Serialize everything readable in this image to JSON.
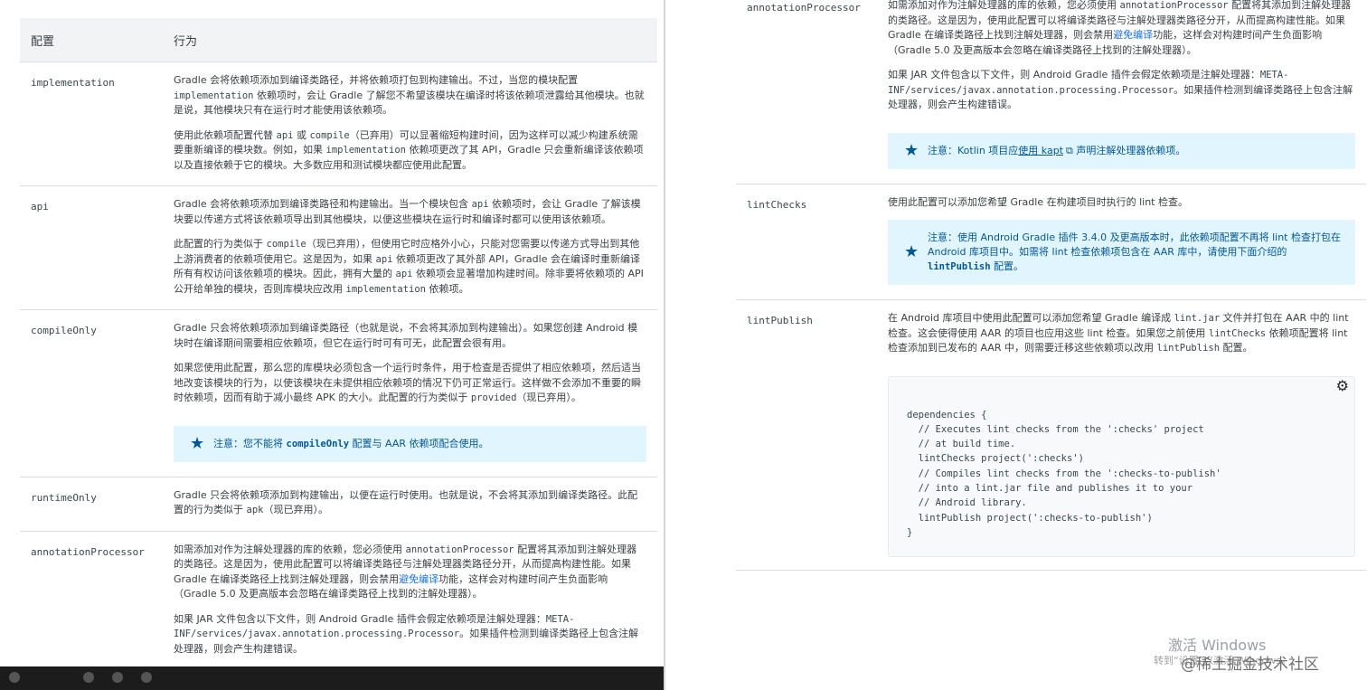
{
  "left": {
    "header": {
      "config": "配置",
      "behavior": "行为"
    },
    "rows": [
      {
        "name": "implementation",
        "paras": [
          [
            "Gradle 会将依赖项添加到编译类路径，并将依赖项打包到构建输出。不过，当您的模块配置 ",
            {
              "code": "implementation"
            },
            " 依赖项时，会让 Gradle 了解您不希望该模块在编译时将该依赖项泄露给其他模块。也就是说，其他模块只有在运行时才能使用该依赖项。"
          ],
          [
            "使用此依赖项配置代替 ",
            {
              "code": "api"
            },
            " 或 ",
            {
              "code": "compile"
            },
            "（已弃用）可以显著缩短构建时间，因为这样可以减少构建系统需要重新编译的模块数。例如，如果 ",
            {
              "code": "implementation"
            },
            " 依赖项更改了其 API，Gradle 只会重新编译该依赖项以及直接依赖于它的模块。大多数应用和测试模块都应使用此配置。"
          ]
        ]
      },
      {
        "name": "api",
        "paras": [
          [
            "Gradle 会将依赖项添加到编译类路径和构建输出。当一个模块包含 ",
            {
              "code": "api"
            },
            " 依赖项时，会让 Gradle 了解该模块要以传递方式将该依赖项导出到其他模块，以便这些模块在运行时和编译时都可以使用该依赖项。"
          ],
          [
            "此配置的行为类似于 ",
            {
              "code": "compile"
            },
            "（现已弃用），但使用它时应格外小心，只能对您需要以传递方式导出到其他上游消费者的依赖项使用它。这是因为，如果 ",
            {
              "code": "api"
            },
            " 依赖项更改了其外部 API，Gradle 会在编译时重新编译所有有权访问该依赖项的模块。因此，拥有大量的 ",
            {
              "code": "api"
            },
            " 依赖项会显著增加构建时间。除非要将依赖项的 API 公开给单独的模块，否则库模块应改用 ",
            {
              "code": "implementation"
            },
            " 依赖项。"
          ]
        ]
      },
      {
        "name": "compileOnly",
        "paras": [
          [
            "Gradle 只会将依赖项添加到编译类路径（也就是说，不会将其添加到构建输出）。如果您创建 Android 模块时在编译期间需要相应依赖项，但它在运行时可有可无，此配置会很有用。"
          ],
          [
            "如果您使用此配置，那么您的库模块必须包含一个运行时条件，用于检查是否提供了相应依赖项，然后适当地改变该模块的行为，以使该模块在未提供相应依赖项的情况下仍可正常运行。这样做不会添加不重要的瞬时依赖项，因而有助于减小最终 APK 的大小。此配置的行为类似于 ",
            {
              "code": "provided"
            },
            "（现已弃用）。"
          ]
        ],
        "note": [
          "注意：您不能将 ",
          {
            "code": "compileOnly"
          },
          " 配置与 AAR 依赖项配合使用。"
        ]
      },
      {
        "name": "runtimeOnly",
        "paras": [
          [
            "Gradle 只会将依赖项添加到构建输出，以便在运行时使用。也就是说，不会将其添加到编译类路径。此配置的行为类似于 ",
            {
              "code": "apk"
            },
            "（现已弃用）。"
          ]
        ]
      },
      {
        "name": "annotationProcessor",
        "paras": [
          [
            "如需添加对作为注解处理器的库的依赖，您必须使用 ",
            {
              "code": "annotationProcessor"
            },
            " 配置将其添加到注解处理器的类路径。这是因为，使用此配置可以将编译类路径与注解处理器类路径分开，从而提高构建性能。如果 Gradle 在编译类路径上找到注解处理器，则会禁用",
            {
              "link": "避免编译"
            },
            "功能，这样会对构建时间产生负面影响（Gradle 5.0 及更高版本会忽略在编译类路径上找到的注解处理器）。"
          ],
          [
            "如果 JAR 文件包含以下文件，则 Android Gradle 插件会假定依赖项是注解处理器：",
            {
              "code": "META-INF/services/javax.annotation.processing.Processor"
            },
            "。如果插件检测到编译类路径上包含注解处理器，则会产生构建错误。"
          ]
        ]
      }
    ]
  },
  "right": {
    "rows": [
      {
        "name": "annotationProcessor",
        "paras": [
          [
            "如需添加对作为注解处理器的库的依赖，您必须使用 ",
            {
              "code": "annotationProcessor"
            },
            " 配置将其添加到注解处理器的类路径。这是因为，使用此配置可以将编译类路径与注解处理器类路径分开，从而提高构建性能。如果 Gradle 在编译类路径上找到注解处理器，则会禁用",
            {
              "link": "避免编译"
            },
            "功能，这样会对构建时间产生负面影响（Gradle 5.0 及更高版本会忽略在编译类路径上找到的注解处理器）。"
          ],
          [
            "如果 JAR 文件包含以下文件，则 Android Gradle 插件会假定依赖项是注解处理器：",
            {
              "code": "META-INF/services/javax.annotation.processing.Processor"
            },
            "。如果插件检测到编译类路径上包含注解处理器，则会产生构建错误。"
          ]
        ],
        "note": [
          "注意：Kotlin 项目应",
          {
            "link": "使用 kapt"
          },
          {
            "ext": "⧉"
          },
          " 声明注解处理器依赖项。"
        ]
      },
      {
        "name": "lintChecks",
        "paras": [
          [
            "使用此配置可以添加您希望 Gradle 在构建项目时执行的 lint 检查。"
          ]
        ],
        "note": [
          "注意：使用 Android Gradle 插件 3.4.0 及更高版本时，此依赖项配置不再将 lint 检查打包在 Android 库项目中。如需将 lint 检查依赖项包含在 AAR 库中，请使用下面介绍的 ",
          {
            "code": "lintPublish"
          },
          " 配置。"
        ],
        "note_tight": true
      },
      {
        "name": "lintPublish",
        "paras": [
          [
            "在 Android 库项目中使用此配置可以添加您希望 Gradle 编译成 ",
            {
              "code": "lint.jar"
            },
            " 文件并打包在 AAR 中的 lint 检查。这会使得使用 AAR 的项目也应用这些 lint 检查。如果您之前使用 ",
            {
              "code": "lintChecks"
            },
            " 依赖项配置将 lint 检查添加到已发布的 AAR 中，则需要迁移这些依赖项以改用 ",
            {
              "code": "lintPublish"
            },
            " 配置。"
          ]
        ],
        "code_block": "dependencies {\n  // Executes lint checks from the ':checks' project\n  // at build time.\n  lintChecks project(':checks')\n  // Compiles lint checks from the ':checks-to-publish'\n  // into a lint.jar file and publishes it to your\n  // Android library.\n  lintPublish project(':checks-to-publish')\n}"
      }
    ],
    "watermark": {
      "activate": "激活 Windows",
      "activate_sub": "转到“设置”以激活 Windows。",
      "juejin": "@稀土掘金技术社区"
    }
  }
}
